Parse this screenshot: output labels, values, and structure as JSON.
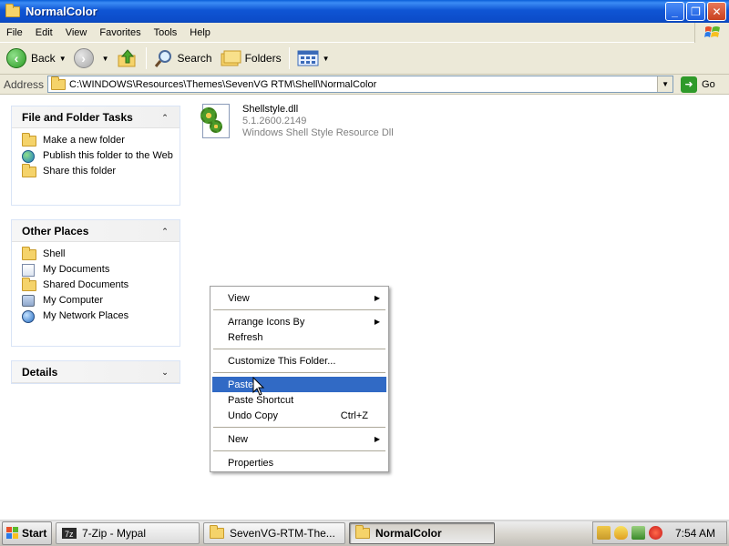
{
  "window": {
    "title": "NormalColor",
    "minimize": "_",
    "maximize": "❐",
    "close": "✕"
  },
  "menu": [
    "File",
    "Edit",
    "View",
    "Favorites",
    "Tools",
    "Help"
  ],
  "toolbar": {
    "back_label": "Back",
    "search_label": "Search",
    "folders_label": "Folders"
  },
  "address": {
    "label": "Address",
    "value": "C:\\WINDOWS\\Resources\\Themes\\SevenVG RTM\\Shell\\NormalColor",
    "go_label": "Go"
  },
  "tasks": {
    "file_folder": {
      "title": "File and Folder Tasks",
      "items": [
        "Make a new folder",
        "Publish this folder to the Web",
        "Share this folder"
      ]
    },
    "other_places": {
      "title": "Other Places",
      "items": [
        "Shell",
        "My Documents",
        "Shared Documents",
        "My Computer",
        "My Network Places"
      ]
    },
    "details": {
      "title": "Details"
    }
  },
  "file": {
    "name": "Shellstyle.dll",
    "version": "5.1.2600.2149",
    "description": "Windows Shell Style Resource Dll"
  },
  "context_menu": {
    "view": "View",
    "arrange": "Arrange Icons By",
    "refresh": "Refresh",
    "customize": "Customize This Folder...",
    "paste": "Paste",
    "paste_shortcut": "Paste Shortcut",
    "undo": "Undo Copy",
    "undo_shortcut": "Ctrl+Z",
    "new": "New",
    "properties": "Properties",
    "highlighted": "Paste"
  },
  "taskbar": {
    "start_label": "Start",
    "buttons": [
      "7-Zip - Mypal",
      "SevenVG-RTM-The...",
      "NormalColor"
    ],
    "active": "NormalColor",
    "clock": "7:54 AM"
  },
  "colors": {
    "title_blue": "#0c4cc9",
    "highlight": "#316ac5",
    "taskpane_head": "#f0f0f0"
  }
}
